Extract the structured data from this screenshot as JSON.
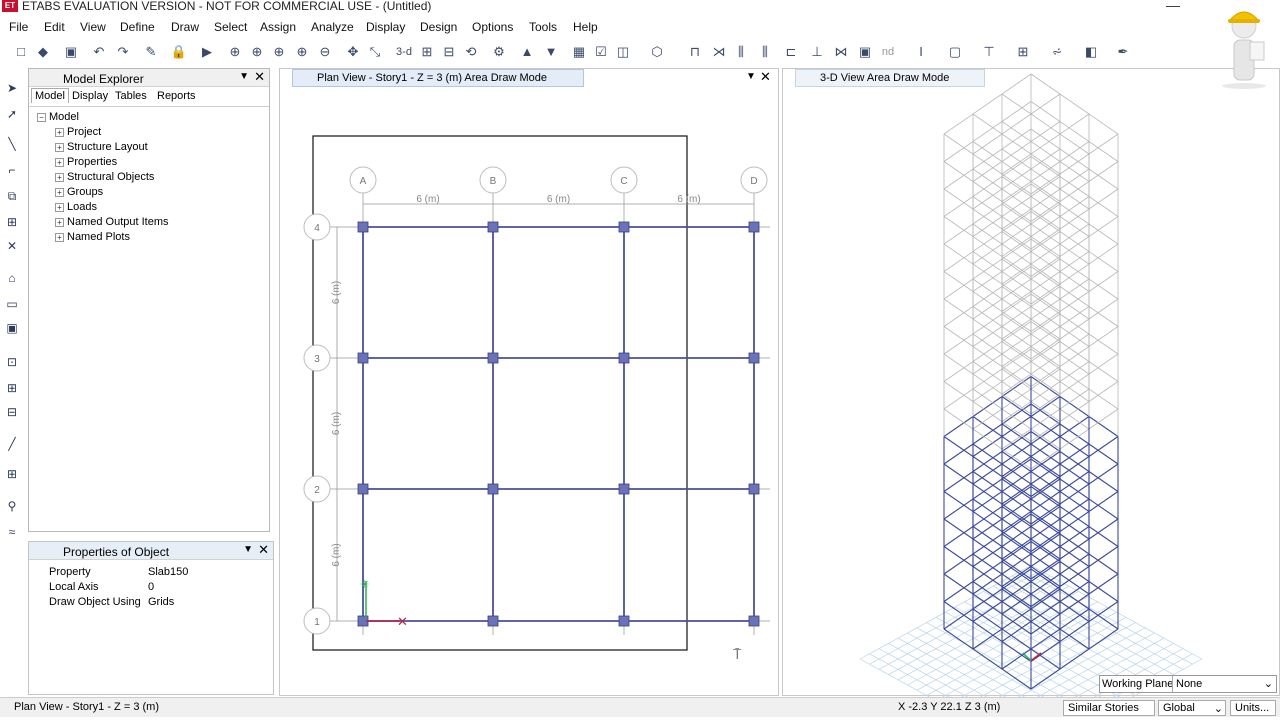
{
  "window": {
    "title": "ETABS EVALUATION VERSION - NOT FOR COMMERCIAL USE - (Untitled)",
    "minimize": "—",
    "app_icon": "ET"
  },
  "menu": [
    "File",
    "Edit",
    "View",
    "Define",
    "Draw",
    "Select",
    "Assign",
    "Analyze",
    "Display",
    "Design",
    "Options",
    "Tools",
    "Help"
  ],
  "toolbar": {
    "view3d_label": "3-d",
    "nd_label": "nd"
  },
  "model_explorer": {
    "title": "Model Explorer",
    "tabs": [
      "Model",
      "Display",
      "Tables",
      "Reports"
    ],
    "root": "Model",
    "items": [
      "Project",
      "Structure Layout",
      "Properties",
      "Structural Objects",
      "Groups",
      "Loads",
      "Named Output Items",
      "Named Plots"
    ]
  },
  "properties_panel": {
    "title": "Properties of Object",
    "rows": [
      {
        "label": "Property",
        "value": "Slab150"
      },
      {
        "label": "Local Axis",
        "value": "0"
      },
      {
        "label": "Draw Object Using",
        "value": "Grids"
      }
    ]
  },
  "plan_view": {
    "tab": "Plan View - Story1 - Z = 3 (m)  Area Draw Mode",
    "grid_x": [
      "A",
      "B",
      "C",
      "D"
    ],
    "grid_y": [
      "4",
      "3",
      "2",
      "1"
    ],
    "spacing_label": "6 (m)"
  },
  "view_3d": {
    "tab": "3-D View  Area Draw Mode"
  },
  "working_plane": {
    "label": "Working Plane",
    "value": "None"
  },
  "status": {
    "left": "Plan View - Story1 - Z = 3 (m)",
    "coords": "X -2.3  Y 22.1  Z 3 (m)",
    "stories": "Similar Stories",
    "system": "Global",
    "units": "Units..."
  },
  "colors": {
    "frame": "#4a4f9a",
    "joint": "#6a72b8",
    "grid": "#b0b0b0",
    "accent": "#c8102e"
  }
}
